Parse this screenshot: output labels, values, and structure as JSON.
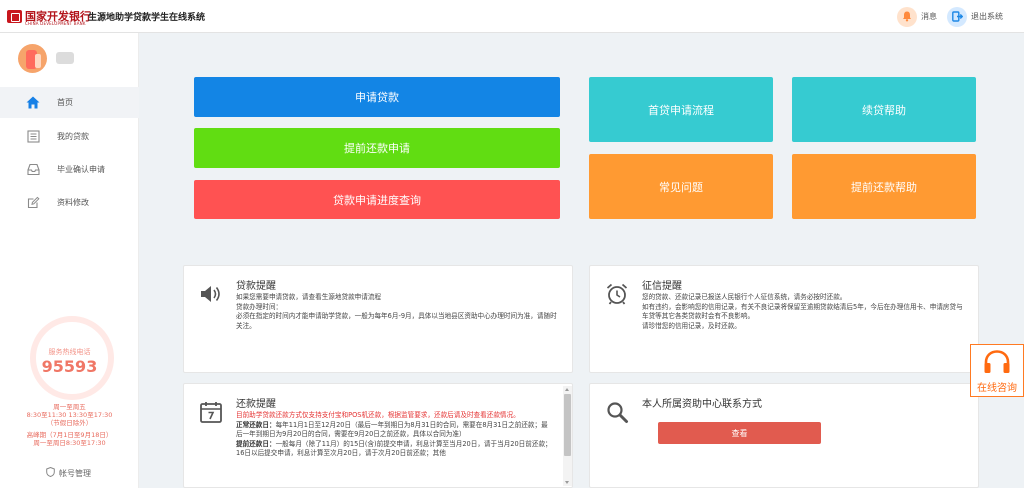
{
  "header": {
    "bank_name": "国家开发银行",
    "bank_name_en": "CHINA DEVELOPMENT BANK",
    "system_title": "生源地助学贷款学生在线系统",
    "message_label": "消息",
    "logout_label": "退出系统"
  },
  "sidebar": {
    "items": [
      {
        "label": "首页",
        "icon": "home-icon"
      },
      {
        "label": "我的贷款",
        "icon": "document-list-icon"
      },
      {
        "label": "毕业确认申请",
        "icon": "inbox-icon"
      },
      {
        "label": "资料修改",
        "icon": "edit-icon"
      }
    ],
    "hotline_label": "服务热线电话",
    "hotline_number": "95593",
    "hours": [
      "周一至周五",
      "8:30至11:30 13:30至17:30",
      "（节假日除外）",
      "高峰期（7月1日至9月18日）",
      "周一至周日8:30至17:30"
    ],
    "account_label": "帐号管理"
  },
  "tiles": {
    "apply": "申请贷款",
    "prepay": "提前还款申请",
    "progress": "贷款申请进度查询",
    "first_flow": "首贷申请流程",
    "renew_help": "续贷帮助",
    "faq": "常见问题",
    "prepay_help": "提前还款帮助"
  },
  "cards": {
    "loan": {
      "title": "贷款提醒",
      "lines": [
        "如果您需要申请贷款，请查看生源地贷款申请流程",
        "贷款办理时间：",
        "必须在指定的时间内才能申请助学贷款，一般为每年6月-9月，具体以当地县区资助中心办理时间为准，请随时关注。"
      ]
    },
    "credit": {
      "title": "征信提醒",
      "lines": [
        "您的贷款、还款记录已报送人民银行个人征信系统，请务必按时还款。",
        "如有违约，会影响您的信用记录，有关不良记录将保留至逾期贷款结清后5年，今后在办理信用卡、申请房贷与车贷等其它各类贷款时会有不良影响。",
        "请珍惜您的信用记录，及时还款。"
      ]
    },
    "repay": {
      "title": "还款提醒",
      "notice": "目前助学贷款还款方式仅支持支付宝和POS机还款，根据监管要求，还款后请及时查看还款情况。",
      "regular_label": "正常还款日：",
      "regular_text": "每年11月1日至12月20日（最后一年到期日为8月31日的合同，需要在8月31日之前还款；最后一年到期日为9月20日的合同，需要在9月20日之前还款，具体以合同为准）",
      "early_label": "提前还款日：",
      "early_text": "一般每月（除了11月）的15日(含)前提交申请，利息计算至当月20日，请于当月20日前还款；16日以后提交申请，利息计算至次月20日，请于次月20日前还款；其他"
    },
    "contact": {
      "title": "本人所属资助中心联系方式",
      "button": "查看"
    }
  },
  "consult_label": "在线咨询",
  "colors": {
    "blue": "#1385e5",
    "green": "#61dd12",
    "red": "#ff5252",
    "teal": "#36cbd1",
    "orange": "#ff9a32",
    "brand_red": "#c8161d"
  }
}
